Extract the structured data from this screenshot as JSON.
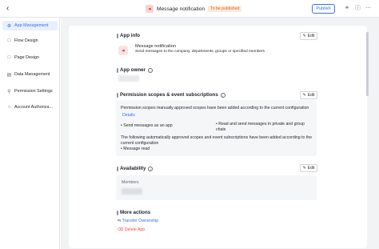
{
  "header": {
    "back_icon": "chevron-left-icon",
    "app_title": "Message notification",
    "status_badge": "To be published",
    "publish_label": "Publish",
    "colors": {
      "accent": "#3370ff",
      "badge_bg": "#fdeadb",
      "badge_text": "#d9681a"
    }
  },
  "sidebar": {
    "items": [
      {
        "label": "App Management",
        "icon": "gear-icon",
        "active": true
      },
      {
        "label": "Flow Design",
        "icon": "page-icon"
      },
      {
        "label": "Page Design",
        "icon": "page-icon"
      },
      {
        "label": "Data Management",
        "icon": "database-icon"
      },
      {
        "label": "Permission Settings",
        "icon": "key-icon"
      },
      {
        "label": "Account Authoriza...",
        "icon": "user-icon"
      }
    ]
  },
  "app_info": {
    "title": "App info",
    "edit_label": "Edit",
    "app_name": "Message notification",
    "app_description": "Send messages to the company, departments, groups or specified members"
  },
  "app_owner": {
    "title": "App owner"
  },
  "permissions": {
    "title": "Permission scopes & event subscriptions",
    "edit_label": "Edit",
    "manual_text": "Permission scopes manually approved scopes have been added according to the current configuration",
    "details_link": "Details",
    "manual_scopes": [
      "Send messages as an app",
      "Read and send messages in private and group chats"
    ],
    "auto_text": "The following automatically approved scopes and event subscriptions have been added according to the current configuration",
    "auto_scopes": [
      "Message read"
    ]
  },
  "availability": {
    "title": "Availability",
    "edit_label": "Edit",
    "members_label": "Members"
  },
  "more_actions": {
    "title": "More actions",
    "transfer_label": "Transfer Ownership",
    "delete_label": "Delete App"
  }
}
